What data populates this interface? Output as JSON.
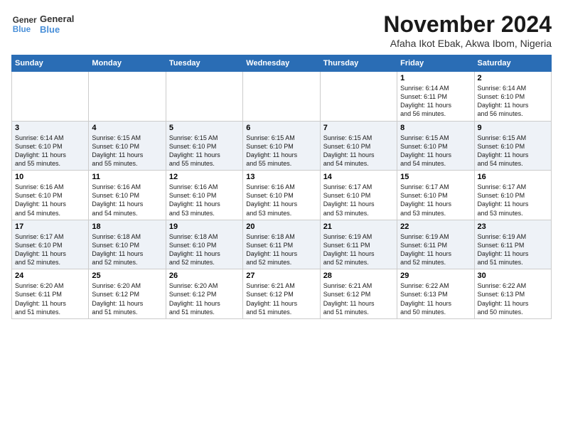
{
  "header": {
    "logo_line1": "General",
    "logo_line2": "Blue",
    "month": "November 2024",
    "location": "Afaha Ikot Ebak, Akwa Ibom, Nigeria"
  },
  "weekdays": [
    "Sunday",
    "Monday",
    "Tuesday",
    "Wednesday",
    "Thursday",
    "Friday",
    "Saturday"
  ],
  "weeks": [
    [
      {
        "day": "",
        "info": ""
      },
      {
        "day": "",
        "info": ""
      },
      {
        "day": "",
        "info": ""
      },
      {
        "day": "",
        "info": ""
      },
      {
        "day": "",
        "info": ""
      },
      {
        "day": "1",
        "info": "Sunrise: 6:14 AM\nSunset: 6:11 PM\nDaylight: 11 hours\nand 56 minutes."
      },
      {
        "day": "2",
        "info": "Sunrise: 6:14 AM\nSunset: 6:10 PM\nDaylight: 11 hours\nand 56 minutes."
      }
    ],
    [
      {
        "day": "3",
        "info": "Sunrise: 6:14 AM\nSunset: 6:10 PM\nDaylight: 11 hours\nand 55 minutes."
      },
      {
        "day": "4",
        "info": "Sunrise: 6:15 AM\nSunset: 6:10 PM\nDaylight: 11 hours\nand 55 minutes."
      },
      {
        "day": "5",
        "info": "Sunrise: 6:15 AM\nSunset: 6:10 PM\nDaylight: 11 hours\nand 55 minutes."
      },
      {
        "day": "6",
        "info": "Sunrise: 6:15 AM\nSunset: 6:10 PM\nDaylight: 11 hours\nand 55 minutes."
      },
      {
        "day": "7",
        "info": "Sunrise: 6:15 AM\nSunset: 6:10 PM\nDaylight: 11 hours\nand 54 minutes."
      },
      {
        "day": "8",
        "info": "Sunrise: 6:15 AM\nSunset: 6:10 PM\nDaylight: 11 hours\nand 54 minutes."
      },
      {
        "day": "9",
        "info": "Sunrise: 6:15 AM\nSunset: 6:10 PM\nDaylight: 11 hours\nand 54 minutes."
      }
    ],
    [
      {
        "day": "10",
        "info": "Sunrise: 6:16 AM\nSunset: 6:10 PM\nDaylight: 11 hours\nand 54 minutes."
      },
      {
        "day": "11",
        "info": "Sunrise: 6:16 AM\nSunset: 6:10 PM\nDaylight: 11 hours\nand 54 minutes."
      },
      {
        "day": "12",
        "info": "Sunrise: 6:16 AM\nSunset: 6:10 PM\nDaylight: 11 hours\nand 53 minutes."
      },
      {
        "day": "13",
        "info": "Sunrise: 6:16 AM\nSunset: 6:10 PM\nDaylight: 11 hours\nand 53 minutes."
      },
      {
        "day": "14",
        "info": "Sunrise: 6:17 AM\nSunset: 6:10 PM\nDaylight: 11 hours\nand 53 minutes."
      },
      {
        "day": "15",
        "info": "Sunrise: 6:17 AM\nSunset: 6:10 PM\nDaylight: 11 hours\nand 53 minutes."
      },
      {
        "day": "16",
        "info": "Sunrise: 6:17 AM\nSunset: 6:10 PM\nDaylight: 11 hours\nand 53 minutes."
      }
    ],
    [
      {
        "day": "17",
        "info": "Sunrise: 6:17 AM\nSunset: 6:10 PM\nDaylight: 11 hours\nand 52 minutes."
      },
      {
        "day": "18",
        "info": "Sunrise: 6:18 AM\nSunset: 6:10 PM\nDaylight: 11 hours\nand 52 minutes."
      },
      {
        "day": "19",
        "info": "Sunrise: 6:18 AM\nSunset: 6:10 PM\nDaylight: 11 hours\nand 52 minutes."
      },
      {
        "day": "20",
        "info": "Sunrise: 6:18 AM\nSunset: 6:11 PM\nDaylight: 11 hours\nand 52 minutes."
      },
      {
        "day": "21",
        "info": "Sunrise: 6:19 AM\nSunset: 6:11 PM\nDaylight: 11 hours\nand 52 minutes."
      },
      {
        "day": "22",
        "info": "Sunrise: 6:19 AM\nSunset: 6:11 PM\nDaylight: 11 hours\nand 52 minutes."
      },
      {
        "day": "23",
        "info": "Sunrise: 6:19 AM\nSunset: 6:11 PM\nDaylight: 11 hours\nand 51 minutes."
      }
    ],
    [
      {
        "day": "24",
        "info": "Sunrise: 6:20 AM\nSunset: 6:11 PM\nDaylight: 11 hours\nand 51 minutes."
      },
      {
        "day": "25",
        "info": "Sunrise: 6:20 AM\nSunset: 6:12 PM\nDaylight: 11 hours\nand 51 minutes."
      },
      {
        "day": "26",
        "info": "Sunrise: 6:20 AM\nSunset: 6:12 PM\nDaylight: 11 hours\nand 51 minutes."
      },
      {
        "day": "27",
        "info": "Sunrise: 6:21 AM\nSunset: 6:12 PM\nDaylight: 11 hours\nand 51 minutes."
      },
      {
        "day": "28",
        "info": "Sunrise: 6:21 AM\nSunset: 6:12 PM\nDaylight: 11 hours\nand 51 minutes."
      },
      {
        "day": "29",
        "info": "Sunrise: 6:22 AM\nSunset: 6:13 PM\nDaylight: 11 hours\nand 50 minutes."
      },
      {
        "day": "30",
        "info": "Sunrise: 6:22 AM\nSunset: 6:13 PM\nDaylight: 11 hours\nand 50 minutes."
      }
    ]
  ]
}
